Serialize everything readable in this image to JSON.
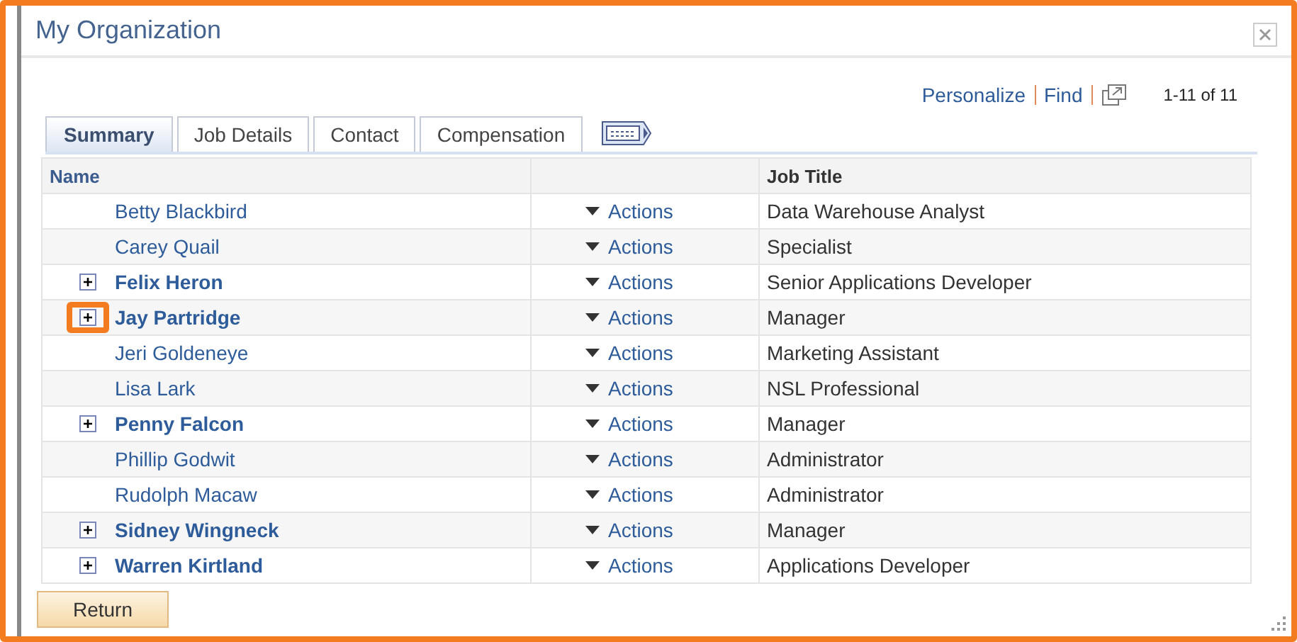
{
  "window": {
    "title": "My Organization"
  },
  "toolbar": {
    "links": [
      "Personalize",
      "Find"
    ],
    "count": "1-11 of 11"
  },
  "tabs": [
    {
      "label": "Summary",
      "selected": true
    },
    {
      "label": "Job Details",
      "selected": false
    },
    {
      "label": "Contact",
      "selected": false
    },
    {
      "label": "Compensation",
      "selected": false
    }
  ],
  "table": {
    "columns": [
      "Name",
      "",
      "Job Title"
    ],
    "rows": [
      {
        "name": "Betty Blackbird",
        "has_reports": false,
        "highlighted": false,
        "action": "Actions",
        "job_title": "Data Warehouse Analyst"
      },
      {
        "name": "Carey Quail",
        "has_reports": false,
        "highlighted": false,
        "action": "Actions",
        "job_title": "Specialist"
      },
      {
        "name": "Felix Heron",
        "has_reports": true,
        "highlighted": false,
        "action": "Actions",
        "job_title": "Senior Applications Developer"
      },
      {
        "name": "Jay Partridge",
        "has_reports": true,
        "highlighted": true,
        "action": "Actions",
        "job_title": "Manager"
      },
      {
        "name": "Jeri Goldeneye",
        "has_reports": false,
        "highlighted": false,
        "action": "Actions",
        "job_title": "Marketing Assistant"
      },
      {
        "name": "Lisa Lark",
        "has_reports": false,
        "highlighted": false,
        "action": "Actions",
        "job_title": "NSL Professional"
      },
      {
        "name": "Penny Falcon",
        "has_reports": true,
        "highlighted": false,
        "action": "Actions",
        "job_title": "Manager"
      },
      {
        "name": "Phillip Godwit",
        "has_reports": false,
        "highlighted": false,
        "action": "Actions",
        "job_title": "Administrator"
      },
      {
        "name": "Rudolph Macaw",
        "has_reports": false,
        "highlighted": false,
        "action": "Actions",
        "job_title": "Administrator"
      },
      {
        "name": "Sidney Wingneck",
        "has_reports": true,
        "highlighted": false,
        "action": "Actions",
        "job_title": "Manager"
      },
      {
        "name": "Warren Kirtland",
        "has_reports": true,
        "highlighted": false,
        "action": "Actions",
        "job_title": "Applications Developer"
      }
    ]
  },
  "buttons": [
    "Return"
  ]
}
